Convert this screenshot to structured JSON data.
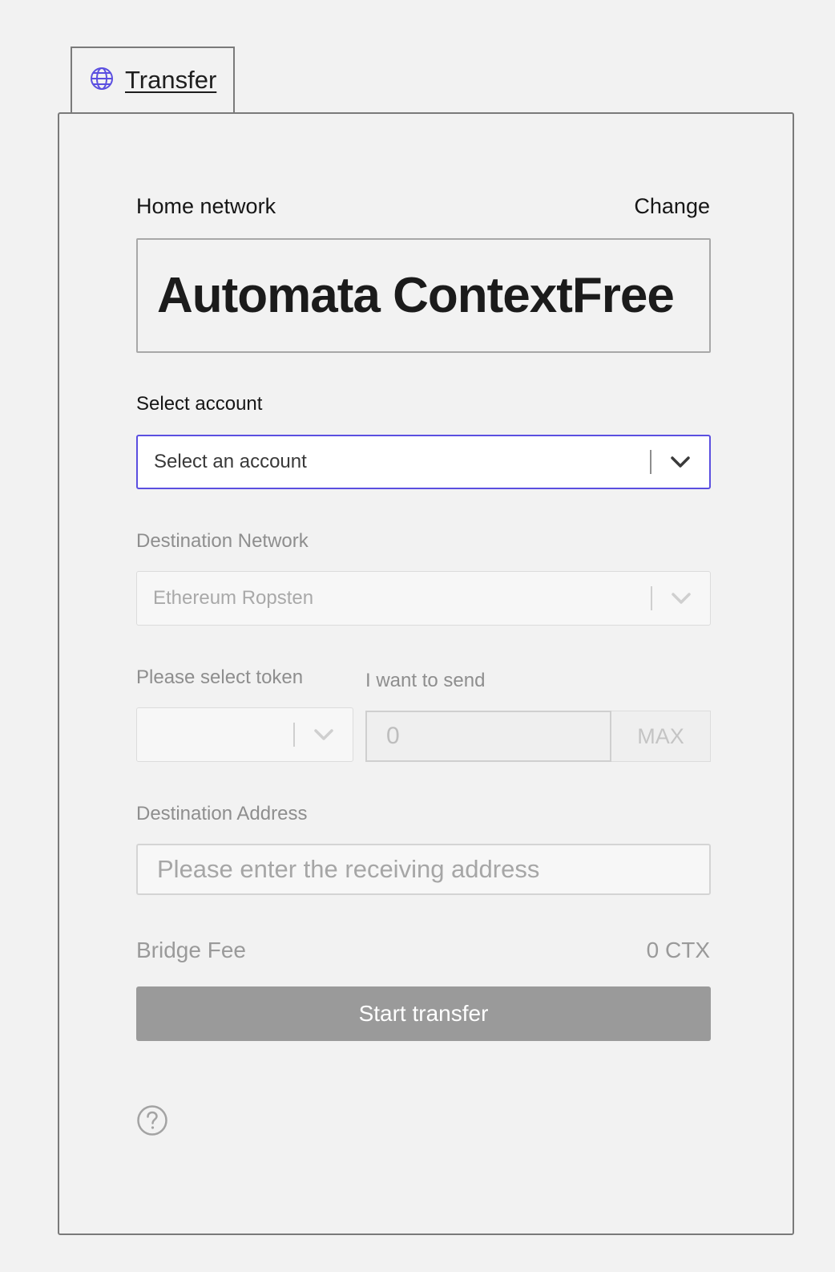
{
  "tab": {
    "label": "Transfer",
    "icon": "globe-icon",
    "accent": "#5b4fe0"
  },
  "home_network": {
    "label": "Home network",
    "change_label": "Change",
    "value": "Automata ContextFree"
  },
  "account": {
    "label": "Select account",
    "placeholder": "Select an account"
  },
  "destination_network": {
    "label": "Destination Network",
    "value": "Ethereum Ropsten"
  },
  "token": {
    "label": "Please select token"
  },
  "amount": {
    "label": "I want to send",
    "placeholder": "0",
    "max_label": "MAX"
  },
  "destination_address": {
    "label": "Destination Address",
    "placeholder": "Please enter the receiving address"
  },
  "fee": {
    "label": "Bridge Fee",
    "value": "0 CTX"
  },
  "start_button": {
    "label": "Start transfer"
  },
  "help": {
    "icon": "help-circle-icon"
  }
}
